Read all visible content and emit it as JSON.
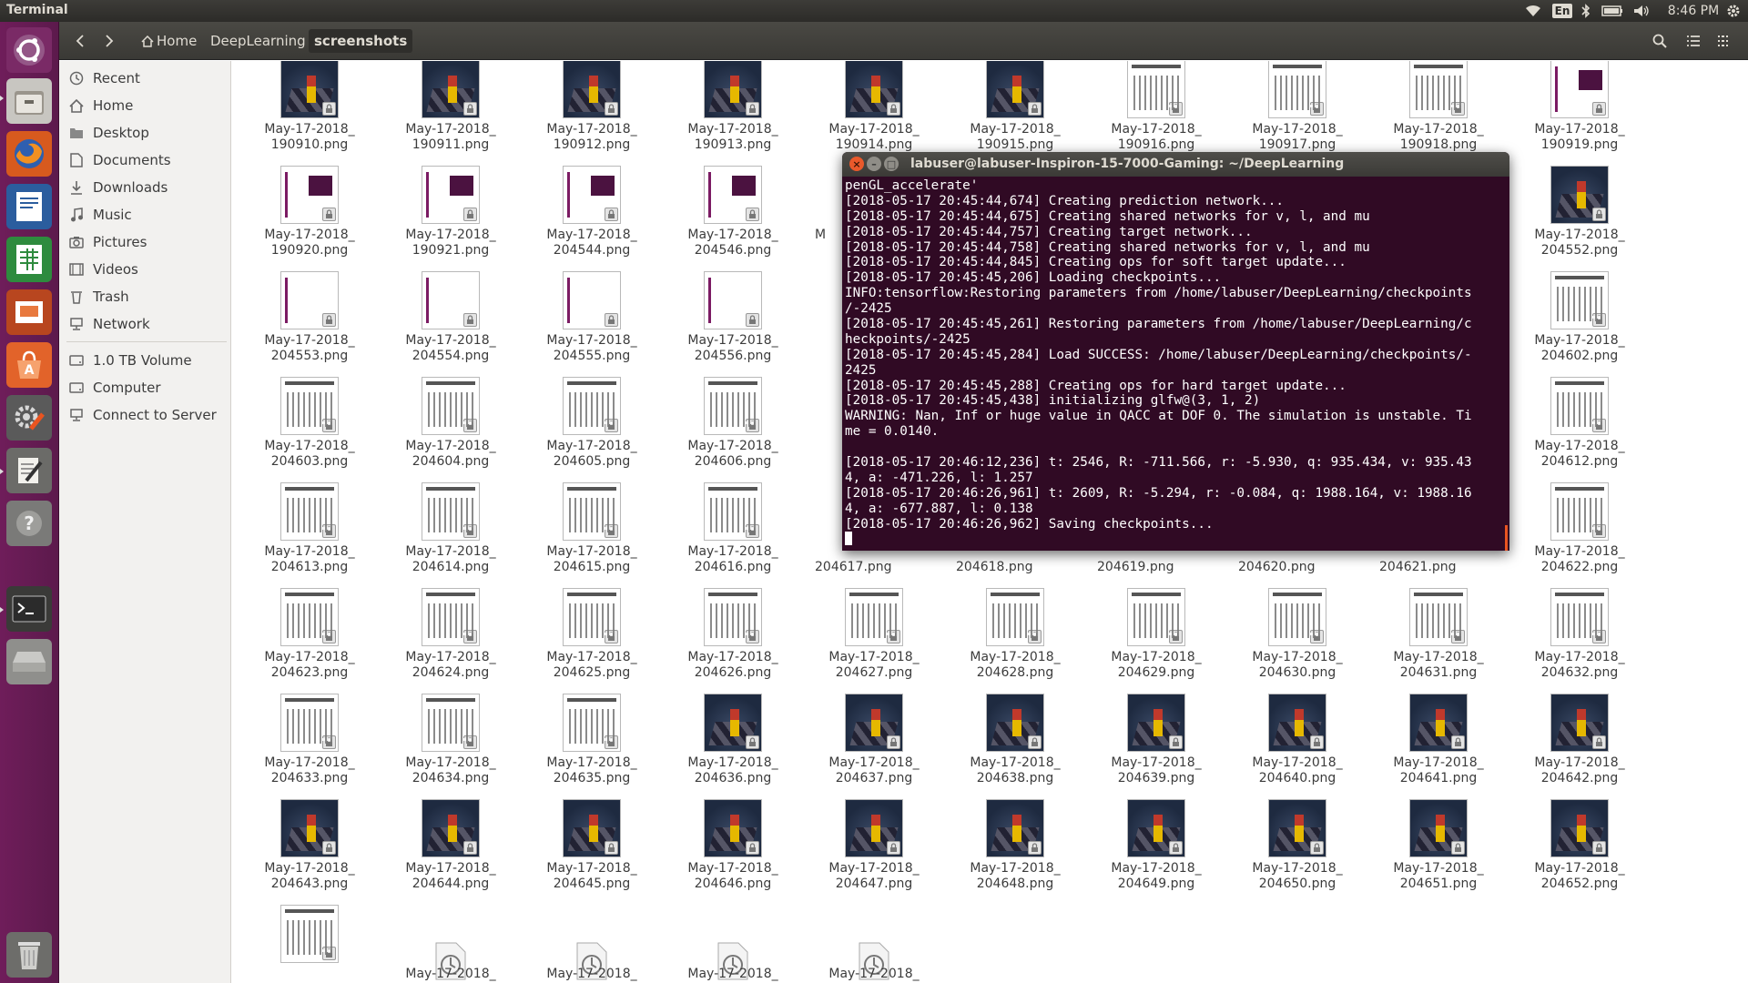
{
  "panel": {
    "app_title": "Terminal",
    "lang": "En",
    "clock": "8:46 PM"
  },
  "toolbar": {
    "crumbs": [
      "Home",
      "DeepLearning",
      "screenshots"
    ]
  },
  "sidebar": {
    "places": [
      "Recent",
      "Home",
      "Desktop",
      "Documents",
      "Downloads",
      "Music",
      "Pictures",
      "Videos",
      "Trash",
      "Network"
    ],
    "devices": [
      "1.0 TB Volume",
      "Computer",
      "Connect to Server"
    ]
  },
  "files": [
    {
      "l1": "May-17-2018_",
      "l2": "190910.png",
      "kind": "scene"
    },
    {
      "l1": "May-17-2018_",
      "l2": "190911.png",
      "kind": "scene"
    },
    {
      "l1": "May-17-2018_",
      "l2": "190912.png",
      "kind": "scene"
    },
    {
      "l1": "May-17-2018_",
      "l2": "190913.png",
      "kind": "scene"
    },
    {
      "l1": "May-17-2018_",
      "l2": "190914.png",
      "kind": "scene"
    },
    {
      "l1": "May-17-2018_",
      "l2": "190915.png",
      "kind": "scene"
    },
    {
      "l1": "May-17-2018_",
      "l2": "190916.png",
      "kind": "grid"
    },
    {
      "l1": "May-17-2018_",
      "l2": "190917.png",
      "kind": "grid"
    },
    {
      "l1": "May-17-2018_",
      "l2": "190918.png",
      "kind": "grid"
    },
    {
      "l1": "May-17-2018_",
      "l2": "190919.png",
      "kind": "shot"
    },
    {
      "l1": "May-17-2018_",
      "l2": "190920.png",
      "kind": "shot"
    },
    {
      "l1": "May-17-2018_",
      "l2": "190921.png",
      "kind": "shot"
    },
    {
      "l1": "May-17-2018_",
      "l2": "204544.png",
      "kind": "shot"
    },
    {
      "l1": "May-17-2018_",
      "l2": "204546.png",
      "kind": "shot"
    },
    {
      "l1": "M",
      "l2": "",
      "kind": "hidden"
    },
    {
      "l1": "",
      "l2": "",
      "kind": "hidden"
    },
    {
      "l1": "",
      "l2": "",
      "kind": "hidden"
    },
    {
      "l1": "",
      "l2": "",
      "kind": "hidden"
    },
    {
      "l1": "",
      "l2": "",
      "kind": "hidden"
    },
    {
      "l1": "May-17-2018_",
      "l2": "204552.png",
      "kind": "scene"
    },
    {
      "l1": "May-17-2018_",
      "l2": "204553.png",
      "kind": "blank"
    },
    {
      "l1": "May-17-2018_",
      "l2": "204554.png",
      "kind": "blank"
    },
    {
      "l1": "May-17-2018_",
      "l2": "204555.png",
      "kind": "blank"
    },
    {
      "l1": "May-17-2018_",
      "l2": "204556.png",
      "kind": "blank"
    },
    {
      "l1": "",
      "l2": "",
      "kind": "hidden"
    },
    {
      "l1": "",
      "l2": "",
      "kind": "hidden"
    },
    {
      "l1": "",
      "l2": "",
      "kind": "hidden"
    },
    {
      "l1": "",
      "l2": "",
      "kind": "hidden"
    },
    {
      "l1": "",
      "l2": "",
      "kind": "hidden"
    },
    {
      "l1": "May-17-2018_",
      "l2": "204602.png",
      "kind": "grid"
    },
    {
      "l1": "May-17-2018_",
      "l2": "204603.png",
      "kind": "grid"
    },
    {
      "l1": "May-17-2018_",
      "l2": "204604.png",
      "kind": "grid"
    },
    {
      "l1": "May-17-2018_",
      "l2": "204605.png",
      "kind": "grid"
    },
    {
      "l1": "May-17-2018_",
      "l2": "204606.png",
      "kind": "grid"
    },
    {
      "l1": "",
      "l2": "",
      "kind": "hidden"
    },
    {
      "l1": "",
      "l2": "",
      "kind": "hidden"
    },
    {
      "l1": "",
      "l2": "",
      "kind": "hidden"
    },
    {
      "l1": "",
      "l2": "",
      "kind": "hidden"
    },
    {
      "l1": "",
      "l2": "",
      "kind": "hidden"
    },
    {
      "l1": "May-17-2018_",
      "l2": "204612.png",
      "kind": "grid"
    },
    {
      "l1": "May-17-2018_",
      "l2": "204613.png",
      "kind": "grid"
    },
    {
      "l1": "May-17-2018_",
      "l2": "204614.png",
      "kind": "grid"
    },
    {
      "l1": "May-17-2018_",
      "l2": "204615.png",
      "kind": "grid"
    },
    {
      "l1": "May-17-2018_",
      "l2": "204616.png",
      "kind": "grid"
    },
    {
      "l1": "",
      "l2": "204617.png",
      "kind": "hidden"
    },
    {
      "l1": "",
      "l2": "204618.png",
      "kind": "hidden"
    },
    {
      "l1": "",
      "l2": "204619.png",
      "kind": "hidden"
    },
    {
      "l1": "",
      "l2": "204620.png",
      "kind": "hidden"
    },
    {
      "l1": "",
      "l2": "204621.png",
      "kind": "hidden"
    },
    {
      "l1": "May-17-2018_",
      "l2": "204622.png",
      "kind": "grid"
    },
    {
      "l1": "May-17-2018_",
      "l2": "204623.png",
      "kind": "grid"
    },
    {
      "l1": "May-17-2018_",
      "l2": "204624.png",
      "kind": "grid"
    },
    {
      "l1": "May-17-2018_",
      "l2": "204625.png",
      "kind": "grid"
    },
    {
      "l1": "May-17-2018_",
      "l2": "204626.png",
      "kind": "grid"
    },
    {
      "l1": "May-17-2018_",
      "l2": "204627.png",
      "kind": "grid"
    },
    {
      "l1": "May-17-2018_",
      "l2": "204628.png",
      "kind": "grid"
    },
    {
      "l1": "May-17-2018_",
      "l2": "204629.png",
      "kind": "grid"
    },
    {
      "l1": "May-17-2018_",
      "l2": "204630.png",
      "kind": "grid"
    },
    {
      "l1": "May-17-2018_",
      "l2": "204631.png",
      "kind": "grid"
    },
    {
      "l1": "May-17-2018_",
      "l2": "204632.png",
      "kind": "grid"
    },
    {
      "l1": "May-17-2018_",
      "l2": "204633.png",
      "kind": "grid"
    },
    {
      "l1": "May-17-2018_",
      "l2": "204634.png",
      "kind": "grid"
    },
    {
      "l1": "May-17-2018_",
      "l2": "204635.png",
      "kind": "grid"
    },
    {
      "l1": "May-17-2018_",
      "l2": "204636.png",
      "kind": "scene"
    },
    {
      "l1": "May-17-2018_",
      "l2": "204637.png",
      "kind": "scene"
    },
    {
      "l1": "May-17-2018_",
      "l2": "204638.png",
      "kind": "scene"
    },
    {
      "l1": "May-17-2018_",
      "l2": "204639.png",
      "kind": "scene"
    },
    {
      "l1": "May-17-2018_",
      "l2": "204640.png",
      "kind": "scene"
    },
    {
      "l1": "May-17-2018_",
      "l2": "204641.png",
      "kind": "scene"
    },
    {
      "l1": "May-17-2018_",
      "l2": "204642.png",
      "kind": "scene"
    },
    {
      "l1": "May-17-2018_",
      "l2": "204643.png",
      "kind": "scene"
    },
    {
      "l1": "May-17-2018_",
      "l2": "204644.png",
      "kind": "scene"
    },
    {
      "l1": "May-17-2018_",
      "l2": "204645.png",
      "kind": "scene"
    },
    {
      "l1": "May-17-2018_",
      "l2": "204646.png",
      "kind": "scene"
    },
    {
      "l1": "May-17-2018_",
      "l2": "204647.png",
      "kind": "scene"
    },
    {
      "l1": "May-17-2018_",
      "l2": "204648.png",
      "kind": "scene"
    },
    {
      "l1": "May-17-2018_",
      "l2": "204649.png",
      "kind": "scene"
    },
    {
      "l1": "May-17-2018_",
      "l2": "204650.png",
      "kind": "scene"
    },
    {
      "l1": "May-17-2018_",
      "l2": "204651.png",
      "kind": "scene"
    },
    {
      "l1": "May-17-2018_",
      "l2": "204652.png",
      "kind": "scene"
    },
    {
      "l1": "",
      "l2": "",
      "kind": "grid"
    },
    {
      "l1": "May-17-2018_",
      "l2": "",
      "kind": "loading"
    },
    {
      "l1": "May-17-2018_",
      "l2": "",
      "kind": "loading"
    },
    {
      "l1": "May-17-2018_",
      "l2": "",
      "kind": "loading"
    },
    {
      "l1": "May-17-2018_",
      "l2": "",
      "kind": "loading"
    }
  ],
  "terminal": {
    "title": "labuser@labuser-Inspiron-15-7000-Gaming: ~/DeepLearning",
    "lines": [
      "penGL_accelerate'",
      "[2018-05-17 20:45:44,674] Creating prediction network...",
      "[2018-05-17 20:45:44,675] Creating shared networks for v, l, and mu",
      "[2018-05-17 20:45:44,757] Creating target network...",
      "[2018-05-17 20:45:44,758] Creating shared networks for v, l, and mu",
      "[2018-05-17 20:45:44,845] Creating ops for soft target update...",
      "[2018-05-17 20:45:45,206] Loading checkpoints...",
      "INFO:tensorflow:Restoring parameters from /home/labuser/DeepLearning/checkpoints",
      "/-2425",
      "[2018-05-17 20:45:45,261] Restoring parameters from /home/labuser/DeepLearning/c",
      "heckpoints/-2425",
      "[2018-05-17 20:45:45,284] Load SUCCESS: /home/labuser/DeepLearning/checkpoints/-",
      "2425",
      "[2018-05-17 20:45:45,288] Creating ops for hard target update...",
      "[2018-05-17 20:45:45,438] initializing glfw@(3, 1, 2)",
      "WARNING: Nan, Inf or huge value in QACC at DOF 0. The simulation is unstable. Ti",
      "me = 0.0140.",
      "",
      "[2018-05-17 20:46:12,236] t: 2546, R: -711.566, r: -5.930, q: 935.434, v: 935.43",
      "4, a: -471.226, l: 1.257",
      "[2018-05-17 20:46:26,961] t: 2609, R: -5.294, r: -0.084, q: 1988.164, v: 1988.16",
      "4, a: -677.887, l: 0.138",
      "[2018-05-17 20:46:26,962] Saving checkpoints..."
    ]
  },
  "colors": {
    "terminal_bg": "#300a24",
    "launcher": "#5e1a4f",
    "accent": "#e95420"
  }
}
